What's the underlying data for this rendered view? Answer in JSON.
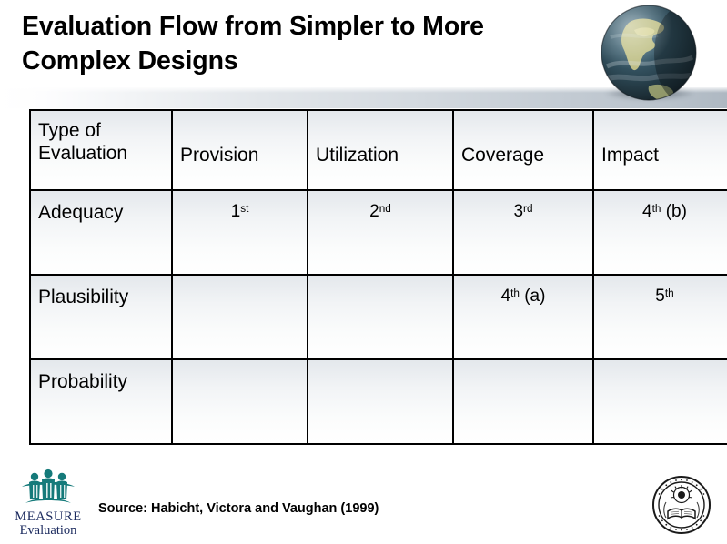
{
  "slide": {
    "title": "Evaluation Flow from Simpler to More Complex Designs"
  },
  "decor": {
    "globe_icon": "globe-earth-image",
    "globe_shadow": "globe-shadow",
    "band": "header-gradient-band",
    "band_gradient_from": "#ffffff",
    "band_gradient_to": "#aeb8c2"
  },
  "table": {
    "headers": [
      {
        "label": "Type of\nEvaluation",
        "name": "type-of-evaluation"
      },
      {
        "label": "Provision",
        "name": "provision"
      },
      {
        "label": "Utilization",
        "name": "utilization"
      },
      {
        "label": "Coverage",
        "name": "coverage"
      },
      {
        "label": "Impact",
        "name": "impact"
      }
    ],
    "rows": [
      {
        "label": "Adequacy",
        "cells": [
          {
            "num": "1",
            "ord": "st",
            "suffix": ""
          },
          {
            "num": "2",
            "ord": "nd",
            "suffix": ""
          },
          {
            "num": "3",
            "ord": "rd",
            "suffix": ""
          },
          {
            "num": "4",
            "ord": "th",
            "suffix": " (b)"
          }
        ]
      },
      {
        "label": "Plausibility",
        "cells": [
          {
            "num": "",
            "ord": "",
            "suffix": ""
          },
          {
            "num": "",
            "ord": "",
            "suffix": ""
          },
          {
            "num": "4",
            "ord": "th",
            "suffix": " (a)"
          },
          {
            "num": "5",
            "ord": "th",
            "suffix": ""
          }
        ]
      },
      {
        "label": "Probability",
        "cells": [
          {
            "num": "",
            "ord": "",
            "suffix": ""
          },
          {
            "num": "",
            "ord": "",
            "suffix": ""
          },
          {
            "num": "",
            "ord": "",
            "suffix": ""
          },
          {
            "num": "",
            "ord": "",
            "suffix": ""
          }
        ]
      }
    ]
  },
  "footer": {
    "source": "Source: Habicht, Victora and Vaughan (1999)",
    "measure_logo": {
      "line1": "MEASURE",
      "line2": "Evaluation",
      "icon": "measure-evaluation-people-icon",
      "color": "#1b2a5e",
      "figure_color": "#157a7a"
    },
    "seal": {
      "icon": "university-seal-icon"
    }
  }
}
